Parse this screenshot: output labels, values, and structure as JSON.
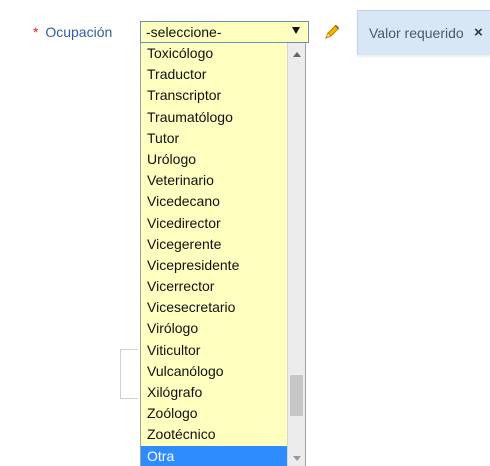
{
  "field": {
    "required_mark": "*",
    "label": "Ocupación",
    "select": {
      "value": "-seleccione-",
      "arrow_icon": "chevron-down-icon"
    },
    "edit_icon": "pencil-icon"
  },
  "tooltip": {
    "text": "Valor requerido",
    "close_icon": "close-icon",
    "close_glyph": "×"
  },
  "dropdown": {
    "options": [
      "Toxicólogo",
      "Traductor",
      "Transcriptor",
      "Traumatólogo",
      "Tutor",
      "Urólogo",
      "Veterinario",
      "Vicedecano",
      "Vicedirector",
      "Vicegerente",
      "Vicepresidente",
      "Vicerrector",
      "Vicesecretario",
      "Virólogo",
      "Viticultor",
      "Vulcanólogo",
      "Xilógrafo",
      "Zoólogo",
      "Zootécnico",
      "Otra"
    ],
    "highlighted_option": "Otra",
    "scroll_position_fraction": 0.9
  },
  "colors": {
    "label": "#2e5ea0",
    "required": "#e02020",
    "select_background": "#ffffc0",
    "highlight": "#2f8cff",
    "tooltip_background": "#d8e7f6",
    "pencil": "#f0a000"
  }
}
